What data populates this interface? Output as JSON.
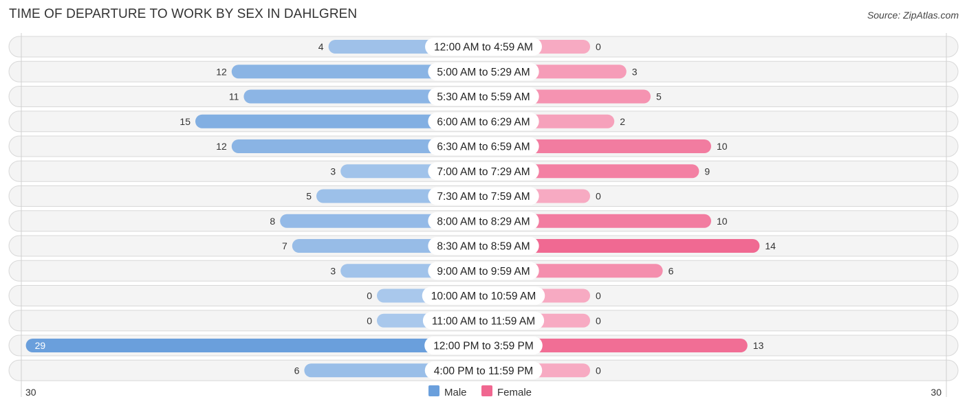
{
  "header": {
    "title": "TIME OF DEPARTURE TO WORK BY SEX IN DAHLGREN",
    "source": "Source: ZipAtlas.com"
  },
  "colors": {
    "male": "#6a9fdc",
    "male_light": "#a9c8ec",
    "female": "#f06790",
    "female_light": "#f7aac2"
  },
  "chart_data": {
    "type": "bar",
    "orientation": "horizontal-diverging",
    "title": "TIME OF DEPARTURE TO WORK BY SEX IN DAHLGREN",
    "categories": [
      "12:00 AM to 4:59 AM",
      "5:00 AM to 5:29 AM",
      "5:30 AM to 5:59 AM",
      "6:00 AM to 6:29 AM",
      "6:30 AM to 6:59 AM",
      "7:00 AM to 7:29 AM",
      "7:30 AM to 7:59 AM",
      "8:00 AM to 8:29 AM",
      "8:30 AM to 8:59 AM",
      "9:00 AM to 9:59 AM",
      "10:00 AM to 10:59 AM",
      "11:00 AM to 11:59 AM",
      "12:00 PM to 3:59 PM",
      "4:00 PM to 11:59 PM"
    ],
    "series": [
      {
        "name": "Male",
        "values": [
          4,
          12,
          11,
          15,
          12,
          3,
          5,
          8,
          7,
          3,
          0,
          0,
          29,
          6
        ]
      },
      {
        "name": "Female",
        "values": [
          0,
          3,
          5,
          2,
          10,
          9,
          0,
          10,
          14,
          6,
          0,
          0,
          13,
          0
        ]
      }
    ],
    "axis": {
      "left_tick": "30",
      "right_tick": "30",
      "max": 30
    },
    "xlim": [
      0,
      30
    ],
    "legend": {
      "position": "bottom-center",
      "items": [
        "Male",
        "Female"
      ]
    },
    "grid": false
  }
}
